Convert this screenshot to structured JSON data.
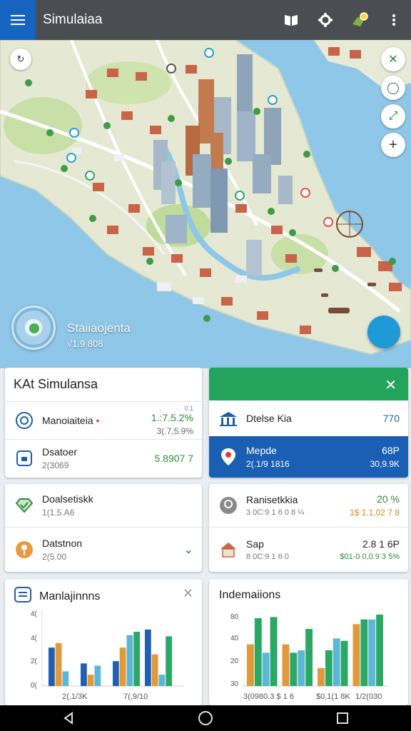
{
  "app": {
    "title": "Simulaiaa"
  },
  "appbar": {
    "menu_icon": "menu-icon",
    "icons": [
      "book-icon",
      "settings-gear-icon",
      "map-badge-icon",
      "more-vert-icon"
    ]
  },
  "map": {
    "compass": "↻",
    "controls": [
      "✕",
      "◯",
      "⤢",
      "+"
    ],
    "stat_title": "Staiiaojenta",
    "stat_value": "√1.9 808"
  },
  "card_kat": {
    "title": "KAt Simulansa",
    "rows": [
      {
        "name": "Manoiaiteia",
        "sub": "",
        "small": "0.1",
        "val1": "1.:7.5.2%",
        "val2": "3(.7,5.9%",
        "val2_color": "#666"
      },
      {
        "name": "Dsatoer",
        "sub": "2(3069",
        "small": "",
        "val1": "",
        "val2": "5.8907 7",
        "val2_color": "#2e8b3e"
      }
    ]
  },
  "card_green": {
    "rows": [
      {
        "name": "Dtelse Kia",
        "sub": "",
        "val1": "770",
        "val2": ""
      },
      {
        "name": "Mepde",
        "sub": "2(.1/9 1816",
        "val1": "68P",
        "val2": "30,9.9K"
      }
    ]
  },
  "card_dual_left": {
    "rows": [
      {
        "name": "Doalsetiskk",
        "sub": "1(1.5.A6"
      },
      {
        "name": "Datstnon",
        "sub": "2(5.00"
      }
    ]
  },
  "card_dual_right": {
    "rows": [
      {
        "name": "Ranisetkkia",
        "sub": "3 0C:9 1 6 0 8 ¼",
        "val1": "20 %",
        "val2": "1$ 1.1,02 7 8"
      },
      {
        "name": "Sap",
        "sub": "8 0C:9 1 6 0",
        "val1": "2.8 1 6P",
        "val2": "$01-0 0,0.9 3 5%"
      }
    ]
  },
  "chart_left": {
    "title": "Manlajinnns",
    "yticks": [
      "4(",
      "4(",
      "2(",
      "0(",
      "0(",
      "0("
    ],
    "xlabels": [
      "2(,1/3K",
      "7(,9/10"
    ]
  },
  "chart_right": {
    "title": "Indemaiions",
    "yticks": [
      "80",
      "40",
      "20",
      "30"
    ],
    "xlabels": [
      "3(0980.3 $ 1 6",
      "$0,1(1 8K",
      "1/2(030"
    ]
  },
  "chart_data": [
    {
      "type": "bar",
      "title": "Manlajinnns",
      "series": [
        {
          "values": [
            34,
            20,
            22,
            50
          ]
        },
        {
          "values": [
            38,
            10,
            34,
            28
          ]
        },
        {
          "values": [
            13,
            18,
            45,
            10
          ]
        },
        {
          "values": [
            0,
            0,
            48,
            44
          ]
        }
      ],
      "colors": [
        "#2160b0",
        "#e09a3a",
        "#5bb7d6",
        "#2aa866"
      ]
    },
    {
      "type": "bar",
      "title": "Indemaiions",
      "series": [
        {
          "values": [
            35,
            35,
            15,
            52
          ]
        },
        {
          "values": [
            57,
            28,
            30,
            56
          ]
        },
        {
          "values": [
            28,
            30,
            40,
            56
          ]
        },
        {
          "values": [
            58,
            48,
            38,
            60
          ]
        }
      ],
      "colors": [
        "#e09a3a",
        "#2aa866",
        "#5bb7d6",
        "#2aa866"
      ]
    }
  ],
  "nav": {
    "back": "back-icon",
    "home": "home-icon",
    "recents": "recents-icon"
  }
}
